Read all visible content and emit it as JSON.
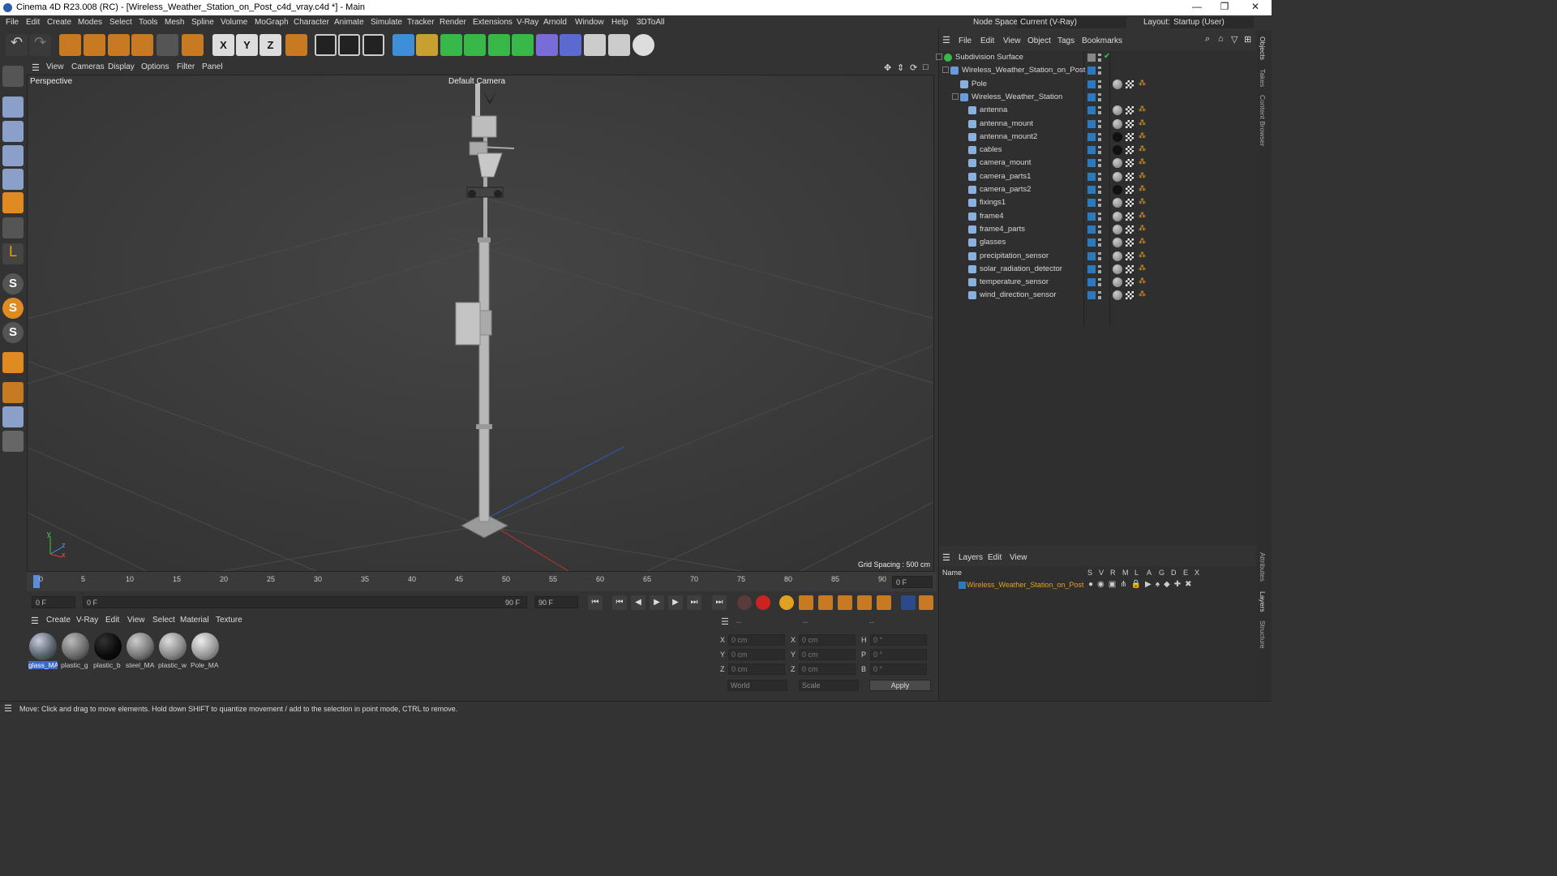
{
  "window": {
    "title": "Cinema 4D R23.008 (RC) - [Wireless_Weather_Station_on_Post_c4d_vray.c4d *] - Main",
    "minimize": "—",
    "maximize": "❐",
    "close": "✕"
  },
  "menubar": {
    "items": [
      "File",
      "Edit",
      "Create",
      "Modes",
      "Select",
      "Tools",
      "Mesh",
      "Spline",
      "Volume",
      "MoGraph",
      "Character",
      "Animate",
      "Simulate",
      "Tracker",
      "Render",
      "Extensions",
      "V-Ray",
      "Arnold",
      "Window",
      "Help",
      "3DToAll"
    ],
    "node_space_label": "Node Space:",
    "node_space_value": "Current (V-Ray)",
    "layout_label": "Layout:",
    "layout_value": "Startup (User)"
  },
  "viewport": {
    "menu": [
      "View",
      "Cameras",
      "Display",
      "Options",
      "Filter",
      "Panel"
    ],
    "label": "Perspective",
    "camera": "Default Camera",
    "grid_spacing": "Grid Spacing : 500 cm",
    "axis_y": "y",
    "axis_z": "z",
    "axis_x": "x"
  },
  "timeline": {
    "ticks": [
      "0",
      "5",
      "10",
      "15",
      "20",
      "25",
      "30",
      "35",
      "40",
      "45",
      "50",
      "55",
      "60",
      "65",
      "70",
      "75",
      "80",
      "85",
      "90"
    ],
    "current_frame": "0 F"
  },
  "transport": {
    "start_field": "0 F",
    "range_start": "0 F",
    "range_end": "90 F",
    "end_field": "90 F"
  },
  "materials": {
    "menu": [
      "Create",
      "V-Ray",
      "Edit",
      "View",
      "Select",
      "Material",
      "Texture"
    ],
    "items": [
      {
        "label": "glass_MA",
        "color": "#5a6670"
      },
      {
        "label": "plastic_g",
        "color": "#6e6e6e"
      },
      {
        "label": "plastic_b",
        "color": "#0b0b0b"
      },
      {
        "label": "steel_MA",
        "color": "#7a7a7a"
      },
      {
        "label": "plastic_w",
        "color": "#8a8a8a"
      },
      {
        "label": "Pole_MA",
        "color": "#9a9a9a"
      }
    ]
  },
  "coords": {
    "header": [
      "--",
      "--",
      "--"
    ],
    "rows": [
      {
        "a": "X",
        "av": "0 cm",
        "b": "X",
        "bv": "0 cm",
        "c": "H",
        "cv": "0 °"
      },
      {
        "a": "Y",
        "av": "0 cm",
        "b": "Y",
        "bv": "0 cm",
        "c": "P",
        "cv": "0 °"
      },
      {
        "a": "Z",
        "av": "0 cm",
        "b": "Z",
        "bv": "0 cm",
        "c": "B",
        "cv": "0 °"
      }
    ],
    "world": "World",
    "scale": "Scale",
    "apply": "Apply"
  },
  "objects": {
    "menu": [
      "File",
      "Edit",
      "View",
      "Object",
      "Tags",
      "Bookmarks"
    ],
    "rows": [
      {
        "name": "Subdivision Surface",
        "indent": 0
      },
      {
        "name": "Wireless_Weather_Station_on_Post",
        "indent": 1
      },
      {
        "name": "Pole",
        "indent": 2
      },
      {
        "name": "Wireless_Weather_Station",
        "indent": 2
      },
      {
        "name": "antenna",
        "indent": 3
      },
      {
        "name": "antenna_mount",
        "indent": 3
      },
      {
        "name": "antenna_mount2",
        "indent": 3
      },
      {
        "name": "cables",
        "indent": 3
      },
      {
        "name": "camera_mount",
        "indent": 3
      },
      {
        "name": "camera_parts1",
        "indent": 3
      },
      {
        "name": "camera_parts2",
        "indent": 3
      },
      {
        "name": "fixings1",
        "indent": 3
      },
      {
        "name": "frame4",
        "indent": 3
      },
      {
        "name": "frame4_parts",
        "indent": 3
      },
      {
        "name": "glasses",
        "indent": 3
      },
      {
        "name": "precipitation_sensor",
        "indent": 3
      },
      {
        "name": "solar_radiation_detector",
        "indent": 3
      },
      {
        "name": "temperature_sensor",
        "indent": 3
      },
      {
        "name": "wind_direction_sensor",
        "indent": 3
      }
    ]
  },
  "layers": {
    "menu": [
      "Layers",
      "Edit",
      "View"
    ],
    "name_header": "Name",
    "col_headers": [
      "S",
      "V",
      "R",
      "M",
      "L",
      "A",
      "G",
      "D",
      "E",
      "X"
    ],
    "row_name": "Wireless_Weather_Station_on_Post"
  },
  "sidetabs": [
    "Objects",
    "Takes",
    "Content Browser",
    "Attributes",
    "Layers",
    "Structure"
  ],
  "status": "Move: Click and drag to move elements. Hold down SHIFT to quantize movement / add to the selection in point mode, CTRL to remove."
}
